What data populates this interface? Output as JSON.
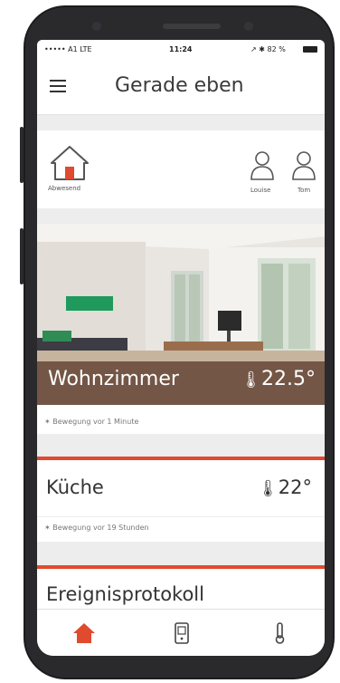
{
  "status_bar": {
    "carrier": "••••• A1  LTE",
    "time": "11:24",
    "battery": "↗ ✱ 82 %"
  },
  "header": {
    "title": "Gerade eben",
    "menu_icon": "hamburger-icon"
  },
  "presence": {
    "home_label": "Abwesend",
    "home_icon": "house-icon",
    "people": [
      {
        "name": "Louise",
        "icon": "person-icon"
      },
      {
        "name": "Tom",
        "icon": "person-icon"
      }
    ]
  },
  "rooms": [
    {
      "name": "Wohnzimmer",
      "temperature": "22.5°",
      "motion": "Bewegung vor 1 Minute"
    },
    {
      "name": "Küche",
      "temperature": "22°",
      "motion": "Bewegung vor 19 Stunden"
    }
  ],
  "event_log": {
    "title": "Ereignisprotokoll"
  },
  "tab_bar": {
    "tabs": [
      {
        "icon": "home-icon",
        "active": true
      },
      {
        "icon": "device-icon",
        "active": false
      },
      {
        "icon": "thermometer-icon",
        "active": false
      }
    ]
  },
  "colors": {
    "accent": "#e04a2e",
    "room_overlay": "#5f3e30"
  }
}
